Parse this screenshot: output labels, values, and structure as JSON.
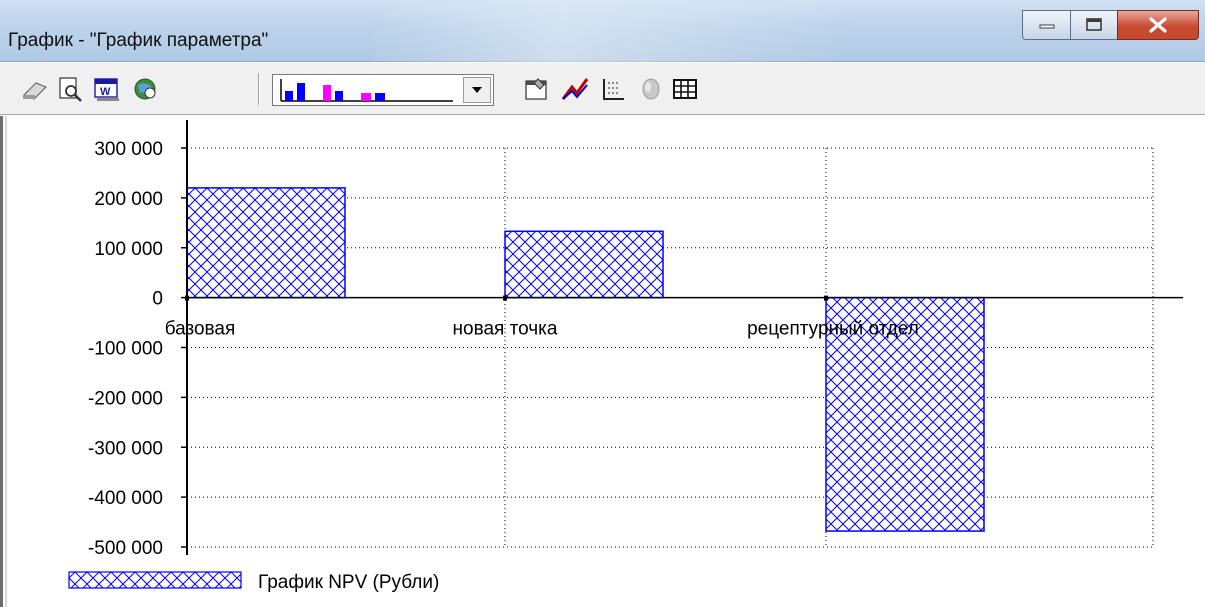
{
  "window": {
    "title": "График - \"График параметра\""
  },
  "toolbar": {
    "icons": [
      "print-icon",
      "print-preview-icon",
      "export-word-icon",
      "web-export-icon",
      "chart-type-combo",
      "properties-icon",
      "line-chart-icon",
      "axes-icon",
      "3d-icon",
      "table-icon"
    ]
  },
  "colors": {
    "bar_stroke": "#0000ff",
    "hatch": "#0000ff",
    "grid": "#000000",
    "axis": "#000000"
  },
  "chart_data": {
    "type": "bar",
    "categories": [
      "базовая",
      "новая точка",
      "рецептурный отдел"
    ],
    "series": [
      {
        "name": "График NPV (Рубли)",
        "values": [
          220000,
          133000,
          -468000
        ]
      }
    ],
    "ylim": [
      -500000,
      300000
    ],
    "yticks": [
      300000,
      200000,
      100000,
      0,
      -100000,
      -200000,
      -300000,
      -400000,
      -500000
    ],
    "ytick_labels": [
      "300 000",
      "200 000",
      "100 000",
      "0",
      "-100 000",
      "-200 000",
      "-300 000",
      "-400 000",
      "-500 000"
    ],
    "grid": true,
    "legend": "bottom-left",
    "pattern": "crosshatch"
  }
}
